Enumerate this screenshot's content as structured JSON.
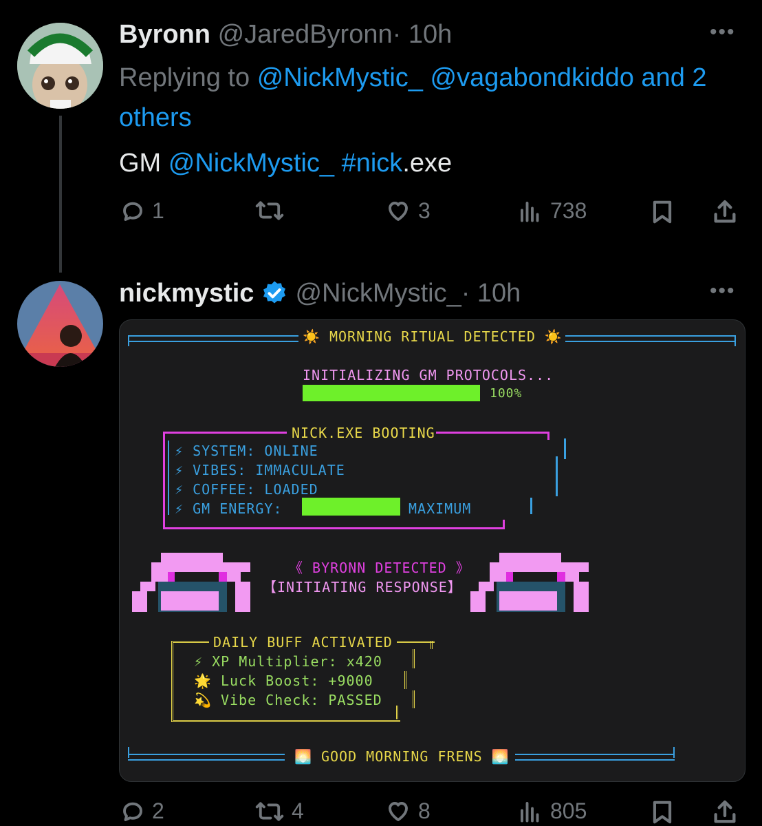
{
  "tweet1": {
    "display_name": "Byronn",
    "handle": "@JaredByronn",
    "time": "· 10h",
    "replying_prefix": "Replying to",
    "replying_mentions": "@NickMystic_ @vagabondkiddo",
    "replying_and": "and",
    "replying_others": "2 others",
    "text_gm": "GM",
    "text_mention": "@NickMystic_",
    "text_hashtag": "#nick",
    "text_suffix": ".exe",
    "stats": {
      "replies": "1",
      "likes": "3",
      "views": "738"
    }
  },
  "tweet2": {
    "display_name": "nickmystic",
    "handle": "@NickMystic_",
    "time": "· 10h",
    "stats": {
      "replies": "2",
      "reposts": "4",
      "likes": "8",
      "views": "805"
    }
  },
  "terminal": {
    "header": "☀️ MORNING RITUAL DETECTED ☀️",
    "init_text": "INITIALIZING GM PROTOCOLS...",
    "progress_percent": "100%",
    "progress_value": 1.0,
    "boot_title": "NICK.EXE BOOTING",
    "boot_lines": [
      "⚡ SYSTEM: ONLINE",
      "⚡ VIBES: IMMACULATE",
      "⚡ COFFEE: LOADED",
      "⚡ GM ENERGY:"
    ],
    "energy_label": "MAXIMUM",
    "detect_line": "《 BYRONN DETECTED 》",
    "response_line": "【INITIATING RESPONSE】",
    "buff_title": "DAILY BUFF ACTIVATED",
    "buff_lines": [
      "⚡ XP Multiplier: x420",
      "🌟 Luck Boost: +9000",
      "💫 Vibe Check: PASSED"
    ],
    "footer": "🌅 GOOD MORNING FRENS 🌅"
  },
  "icons": [
    "reply-icon",
    "repost-icon",
    "like-icon",
    "views-icon",
    "bookmark-icon",
    "share-icon",
    "more-icon",
    "verified-badge-icon"
  ],
  "colors": {
    "link": "#1d9bf0",
    "muted": "#71767b",
    "background": "#000000",
    "verified": "#1d9bf0"
  }
}
